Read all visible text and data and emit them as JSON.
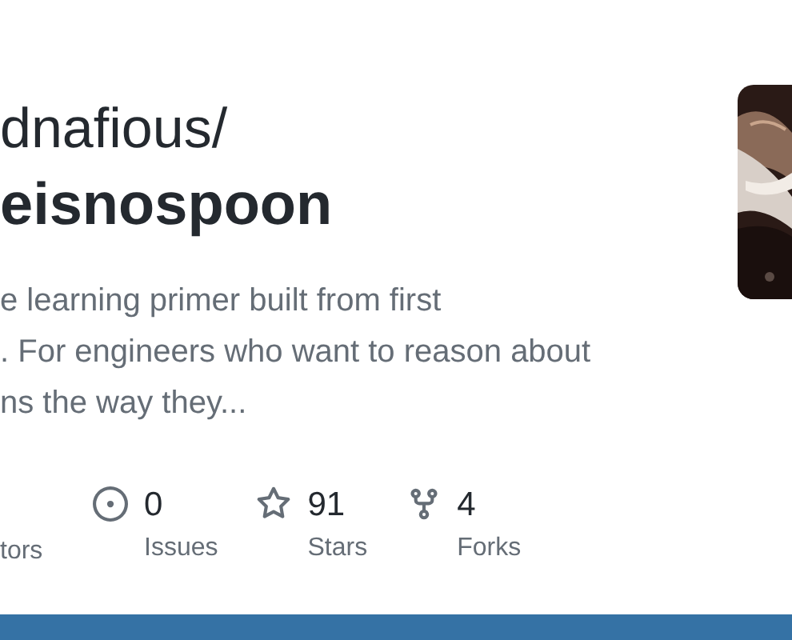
{
  "owner": "dnafious/",
  "repo": "eisnospoon",
  "description": "e learning primer built from first\n. For engineers who want to reason about\nns the way they...",
  "stats": [
    {
      "kind": "contributors",
      "label": "tors"
    },
    {
      "kind": "issues",
      "value": "0",
      "label": "Issues"
    },
    {
      "kind": "stars",
      "value": "91",
      "label": "Stars"
    },
    {
      "kind": "forks",
      "value": "4",
      "label": "Forks"
    }
  ],
  "language_bar": {
    "color": "#3572a5"
  }
}
